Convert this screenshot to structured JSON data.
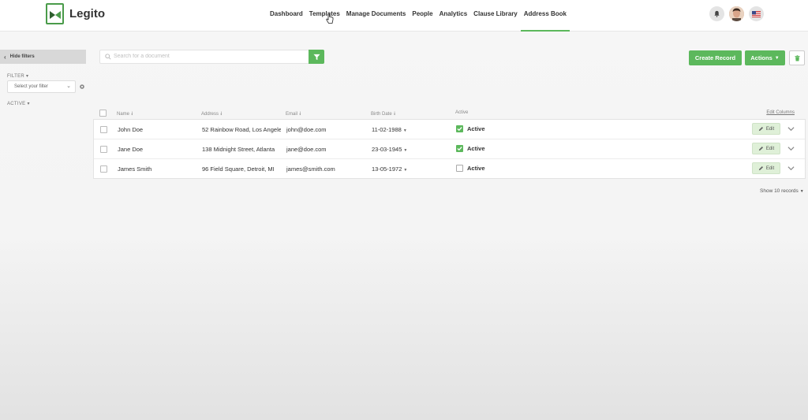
{
  "app": {
    "name": "Legito",
    "colors": {
      "accent": "#5cb85c",
      "accent_dark": "#4a9b4a"
    }
  },
  "nav": {
    "items": [
      {
        "label": "Dashboard",
        "active": false
      },
      {
        "label": "Templates",
        "active": false
      },
      {
        "label": "Manage Documents",
        "active": false
      },
      {
        "label": "People",
        "active": false
      },
      {
        "label": "Analytics",
        "active": false
      },
      {
        "label": "Clause Library",
        "active": false
      },
      {
        "label": "Address Book",
        "active": true
      }
    ]
  },
  "header_icons": [
    "bell-icon",
    "user-avatar",
    "us-flag-icon"
  ],
  "sidebar": {
    "hide_filters": "Hide filters",
    "filter_label": "FILTER",
    "filter_select_placeholder": "Select your filter",
    "active_label": "ACTIVE"
  },
  "toolbar": {
    "search_placeholder": "Search for a document",
    "create_record": "Create Record",
    "actions": "Actions"
  },
  "table": {
    "columns": [
      "Name",
      "Address",
      "Email",
      "Birth Date",
      "Active"
    ],
    "edit_columns": "Edit Columns",
    "edit_label": "Edit",
    "rows": [
      {
        "name": "John Doe",
        "address": "52 Rainbow Road, Los Angeles",
        "email": "john@doe.com",
        "birth_date": "11-02-1988",
        "active": true,
        "active_label": "Active"
      },
      {
        "name": "Jane Doe",
        "address": "138 Midnight Street, Atlanta",
        "email": "jane@doe.com",
        "birth_date": "23-03-1945",
        "active": true,
        "active_label": "Active"
      },
      {
        "name": "James Smith",
        "address": "96 Field Square, Detroit, MI",
        "email": "james@smith.com",
        "birth_date": "13-05-1972",
        "active": false,
        "active_label": "Active"
      }
    ]
  },
  "pagination": {
    "show_records": "Show 10 records"
  }
}
